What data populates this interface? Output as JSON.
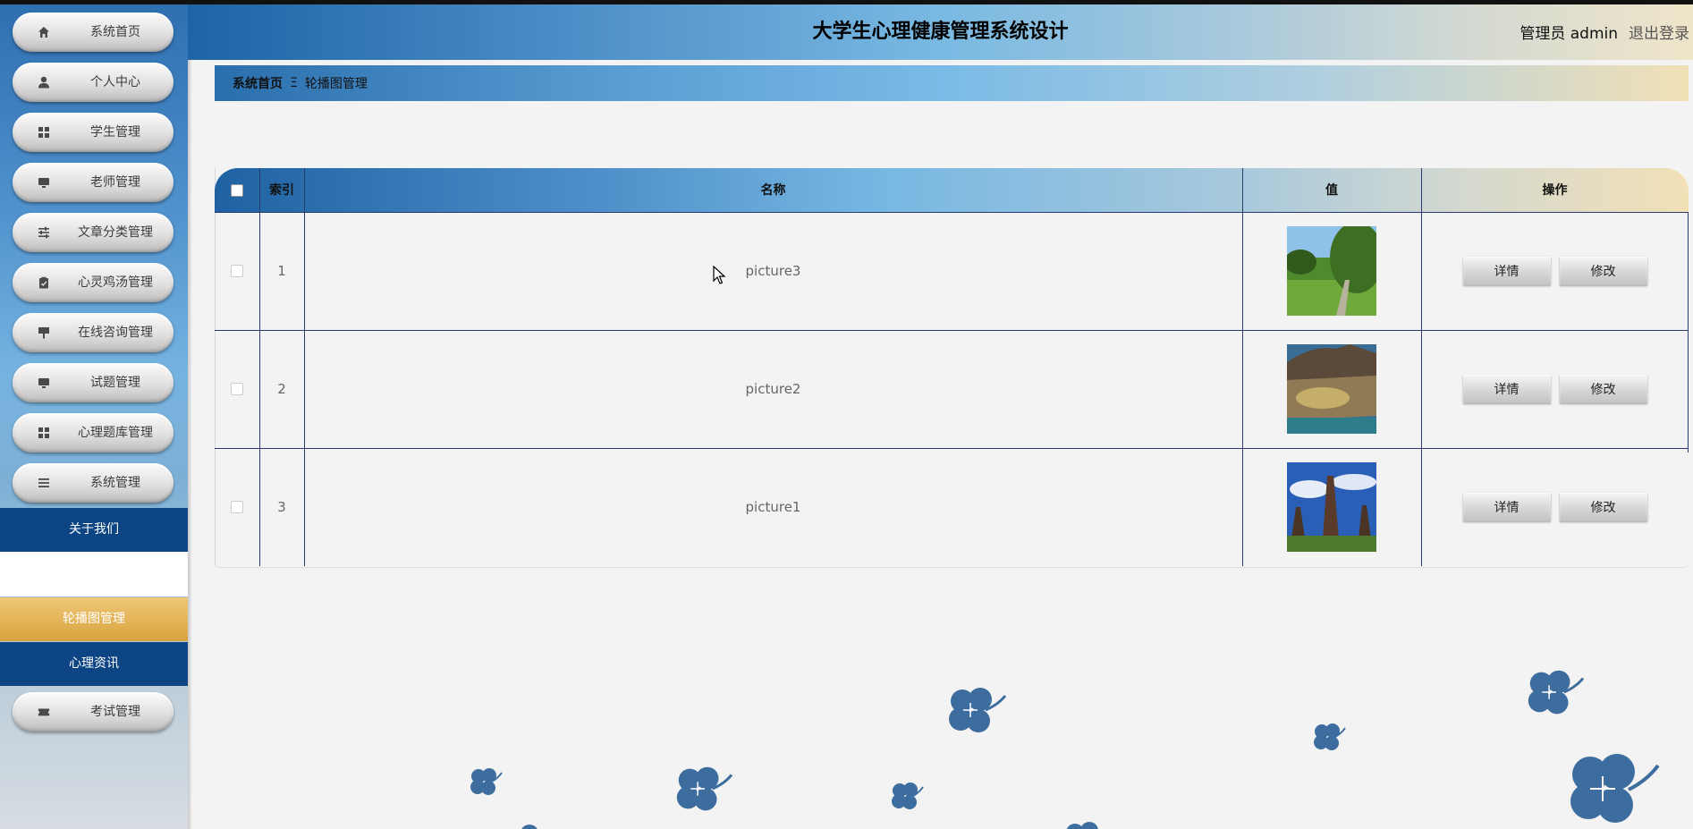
{
  "header": {
    "title": "大学生心理健康管理系统设计",
    "user": "管理员 admin",
    "logout": "退出登录"
  },
  "sidebar": {
    "items": [
      {
        "label": "系统首页",
        "icon": "home-icon"
      },
      {
        "label": "个人中心",
        "icon": "user-icon"
      },
      {
        "label": "学生管理",
        "icon": "grid-icon"
      },
      {
        "label": "老师管理",
        "icon": "monitor-icon"
      },
      {
        "label": "文章分类管理",
        "icon": "sliders-icon"
      },
      {
        "label": "心灵鸡汤管理",
        "icon": "clipboard-icon"
      },
      {
        "label": "在线咨询管理",
        "icon": "sign-icon"
      },
      {
        "label": "试题管理",
        "icon": "monitor-icon"
      },
      {
        "label": "心理题库管理",
        "icon": "grid-icon"
      },
      {
        "label": "系统管理",
        "icon": "list-icon"
      }
    ],
    "about": "关于我们",
    "carousel": "轮播图管理",
    "news": "心理资讯",
    "exam": {
      "label": "考试管理",
      "icon": "ticket-icon"
    }
  },
  "breadcrumb": {
    "home": "系统首页",
    "separator": "Ξ",
    "current": "轮播图管理"
  },
  "table": {
    "headers": {
      "index": "索引",
      "name": "名称",
      "value": "值",
      "actions": "操作"
    },
    "rows": [
      {
        "index": "1",
        "name": "picture3",
        "detail": "详情",
        "edit": "修改"
      },
      {
        "index": "2",
        "name": "picture2",
        "detail": "详情",
        "edit": "修改"
      },
      {
        "index": "3",
        "name": "picture1",
        "detail": "详情",
        "edit": "修改"
      }
    ]
  },
  "colors": {
    "sidebar_blue": "#0d4584",
    "active_gold": "#d8a33d",
    "clover": "#3d6d9e"
  }
}
